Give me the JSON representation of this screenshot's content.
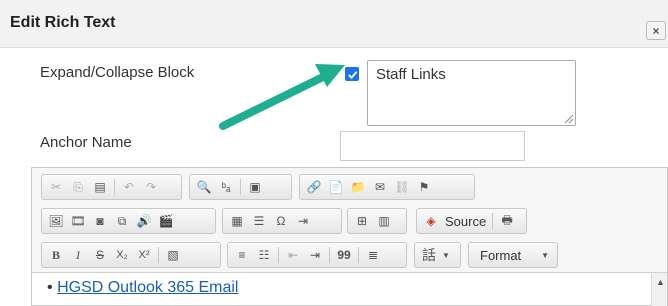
{
  "dialog": {
    "title": "Edit Rich Text",
    "close_label": "×"
  },
  "form": {
    "expand_label": "Expand/Collapse Block",
    "expand_checked": true,
    "block_title_value": "Staff Links",
    "anchor_label": "Anchor Name",
    "anchor_value": ""
  },
  "toolbar": {
    "source_label": "Source",
    "format_label": "Format",
    "bold_label": "B",
    "italic_label": "I",
    "strike_label": "S",
    "sub_label": "X₂",
    "sup_label": "X²",
    "omega_label": "Ω",
    "blockquote_label": "99",
    "lang_label": "話"
  },
  "content": {
    "items": [
      "HGSD Outlook 365 Email"
    ]
  },
  "colors": {
    "arrow": "#1fae8f",
    "checkbox": "#1a73e8",
    "link": "#1a5fb4"
  }
}
